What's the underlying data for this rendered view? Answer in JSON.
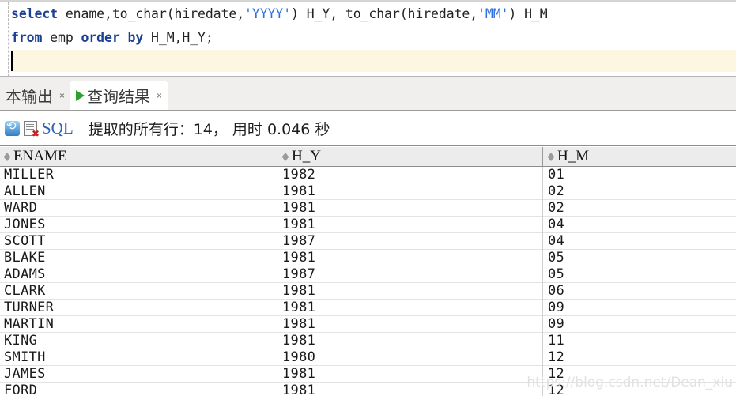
{
  "editor": {
    "lines": [
      [
        {
          "t": "select",
          "c": "kw"
        },
        {
          "t": " ename,to_char(hiredate,",
          "c": "plain"
        },
        {
          "t": "'YYYY'",
          "c": "str"
        },
        {
          "t": ") H_Y, to_char(hiredate,",
          "c": "plain"
        },
        {
          "t": "'MM'",
          "c": "str"
        },
        {
          "t": ") H_M",
          "c": "plain"
        }
      ],
      [
        {
          "t": "from",
          "c": "kw"
        },
        {
          "t": " emp ",
          "c": "plain"
        },
        {
          "t": "order",
          "c": "kw"
        },
        {
          "t": " ",
          "c": "plain"
        },
        {
          "t": "by",
          "c": "kw"
        },
        {
          "t": " H_M,H_Y;",
          "c": "plain"
        }
      ]
    ],
    "keyword_color": "#1c3f94",
    "string_color": "#2f6fe0",
    "current_line_color": "#fdf6e0"
  },
  "tabs": [
    {
      "label": "本输出",
      "close": "×",
      "active": false,
      "icon": ""
    },
    {
      "label": "查询结果",
      "close": "×",
      "active": true,
      "icon": "play-icon"
    }
  ],
  "status": {
    "refresh_icon": "refresh-icon",
    "cancel_icon": "document-error-icon",
    "sql_label": "SQL",
    "text": "提取的所有行：14， 用时  0.046  秒",
    "row_count": 14,
    "elapsed_seconds": 0.046
  },
  "grid": {
    "columns": [
      {
        "name": "ENAME",
        "sort_glyph": "sort-indicator-icon"
      },
      {
        "name": "H_Y",
        "sort_glyph": "sort-indicator-icon"
      },
      {
        "name": "H_M",
        "sort_glyph": "sort-indicator-icon"
      }
    ],
    "rows": [
      [
        "MILLER",
        "1982",
        "01"
      ],
      [
        "ALLEN",
        "1981",
        "02"
      ],
      [
        "WARD",
        "1981",
        "02"
      ],
      [
        "JONES",
        "1981",
        "04"
      ],
      [
        "SCOTT",
        "1987",
        "04"
      ],
      [
        "BLAKE",
        "1981",
        "05"
      ],
      [
        "ADAMS",
        "1987",
        "05"
      ],
      [
        "CLARK",
        "1981",
        "06"
      ],
      [
        "TURNER",
        "1981",
        "09"
      ],
      [
        "MARTIN",
        "1981",
        "09"
      ],
      [
        "KING",
        "1981",
        "11"
      ],
      [
        "SMITH",
        "1980",
        "12"
      ],
      [
        "JAMES",
        "1981",
        "12"
      ],
      [
        "FORD",
        "1981",
        "12"
      ]
    ]
  },
  "watermark": {
    "text": "https://blog.csdn.net/Dean_xiu"
  }
}
